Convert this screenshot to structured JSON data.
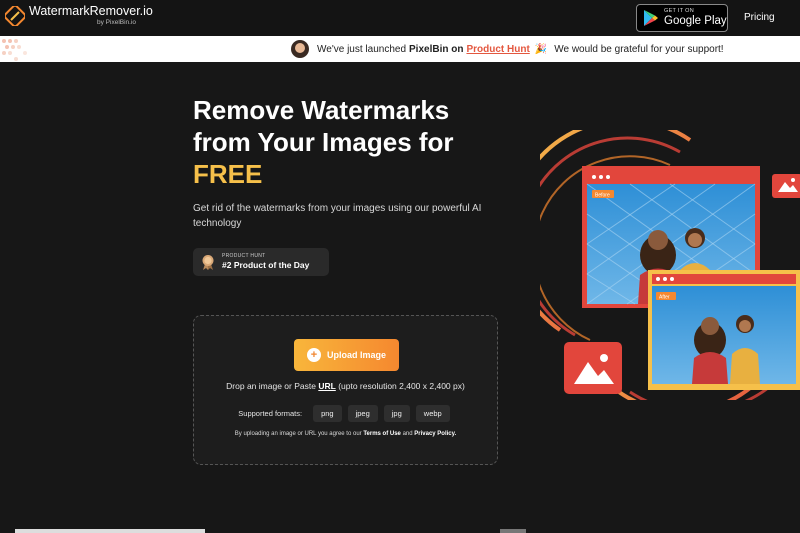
{
  "header": {
    "logo_title": "WatermarkRemover.io",
    "logo_sub": "by PixelBin.io",
    "gplay_small": "GET IT ON",
    "gplay_big": "Google Play",
    "pricing": "Pricing"
  },
  "banner": {
    "text1": "We've just launched",
    "brand": "PixelBin on",
    "link": "Product Hunt",
    "text2": "We would be grateful for your support!"
  },
  "hero": {
    "title": "Remove Watermarks from Your Images for",
    "title_highlight": "FREE",
    "subtitle": "Get rid of the watermarks from your images using our powerful AI technology",
    "badge_small": "PRODUCT HUNT",
    "badge_big": "#2 Product of the Day"
  },
  "upload": {
    "button": "Upload Image",
    "drop_prefix": "Drop an image or Paste",
    "drop_link": "URL",
    "drop_suffix": "(upto resolution 2,400 x 2,400 px)",
    "formats_label": "Supported formats:",
    "formats": [
      "png",
      "jpeg",
      "jpg",
      "webp"
    ],
    "terms_prefix": "By uploading an image or URL you agree to our",
    "terms_link": "Terms of Use",
    "terms_and": "and",
    "privacy_link": "Privacy Policy."
  },
  "illustration": {
    "before_label": "Before",
    "after_label": "After"
  },
  "colors": {
    "accent_yellow": "#f6c04a",
    "accent_orange": "#f5882f",
    "link_red": "#e4573f",
    "background": "#171717"
  }
}
